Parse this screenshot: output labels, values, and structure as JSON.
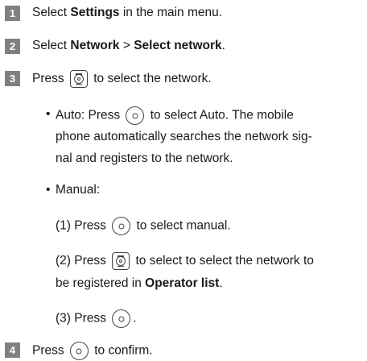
{
  "steps": [
    {
      "num": "1",
      "pre": "Select ",
      "bold": "Settings",
      "post": " in the main menu."
    },
    {
      "num": "2",
      "pre": "Select ",
      "bold1": "Network",
      "mid": " > ",
      "bold2": "Select network",
      "post": "."
    },
    {
      "num": "3",
      "pre": "Press ",
      "post": " to select the network."
    },
    {
      "num": "4",
      "pre": "Press ",
      "post": " to confirm."
    }
  ],
  "auto": {
    "line1_pre": "Auto: Press ",
    "line1_post": " to select Auto. The mobile",
    "line2": "phone automatically searches the  network sig-",
    "line3": "nal and registers to the network."
  },
  "manual": {
    "label": "Manual:",
    "sub1_pre": "(1) Press ",
    "sub1_post": " to select manual.",
    "sub2_pre": "(2) Press ",
    "sub2_post": " to select to select the network to",
    "sub2_line2_pre": "be registered in ",
    "sub2_line2_bold": "Operator list",
    "sub2_line2_post": ".",
    "sub3_pre": "(3) Press ",
    "sub3_post": "."
  },
  "bullet_char": "•",
  "icons": {
    "nav_key": "nav-key-icon",
    "center_key": "center-key-icon"
  }
}
